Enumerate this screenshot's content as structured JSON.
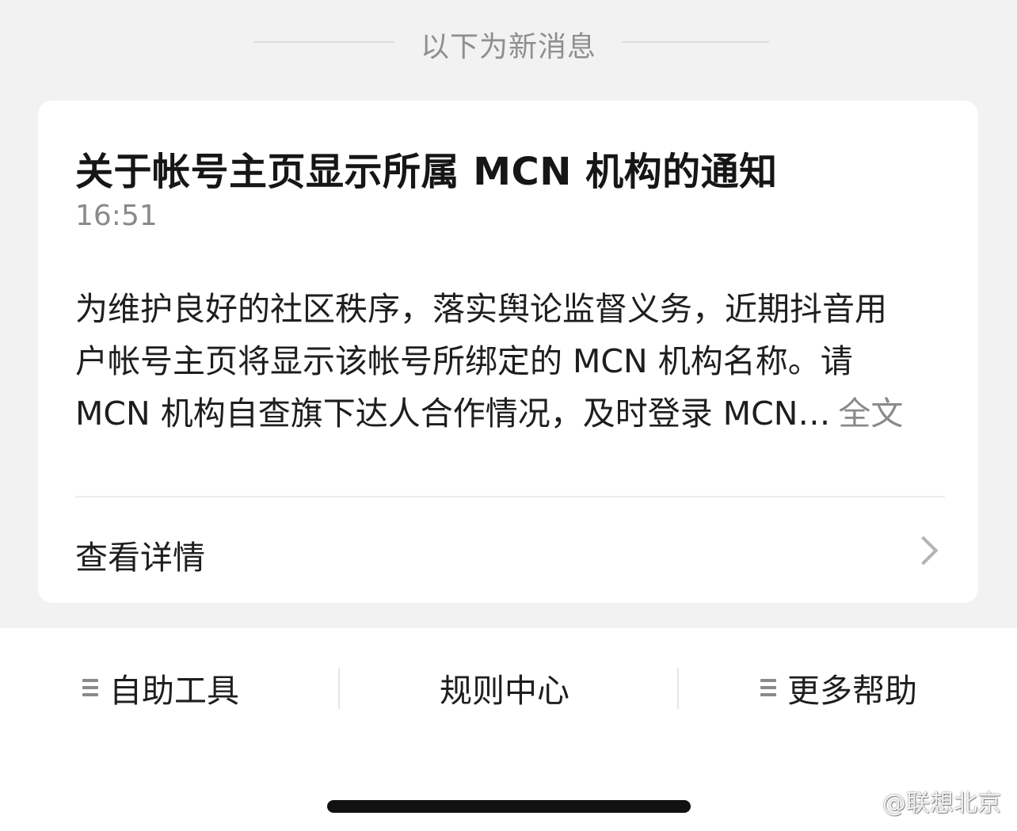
{
  "divider": {
    "label": "以下为新消息"
  },
  "notice": {
    "title": "关于帐号主页显示所属 MCN 机构的通知",
    "time": "16:51",
    "body_lines": [
      "为维护良好的社区秩序，落实舆论监督义务，近期抖音用",
      "户帐号主页将显示该帐号所绑定的 MCN 机构名称。请",
      "MCN 机构自查旗下达人合作情况，及时登录 MCN…"
    ],
    "more_label": "全文",
    "detail_label": "查看详情"
  },
  "menu": {
    "items": [
      {
        "label": "自助工具",
        "icon": "menu-lines-icon"
      },
      {
        "label": "规则中心"
      },
      {
        "label": "更多帮助",
        "icon": "menu-lines-icon"
      }
    ]
  },
  "watermark": {
    "text": "@联想北京"
  },
  "colors": {
    "page_background": "#f2f2f2",
    "card_background": "#ffffff",
    "muted_text": "#8a8a8a",
    "home_indicator": "#111111"
  }
}
